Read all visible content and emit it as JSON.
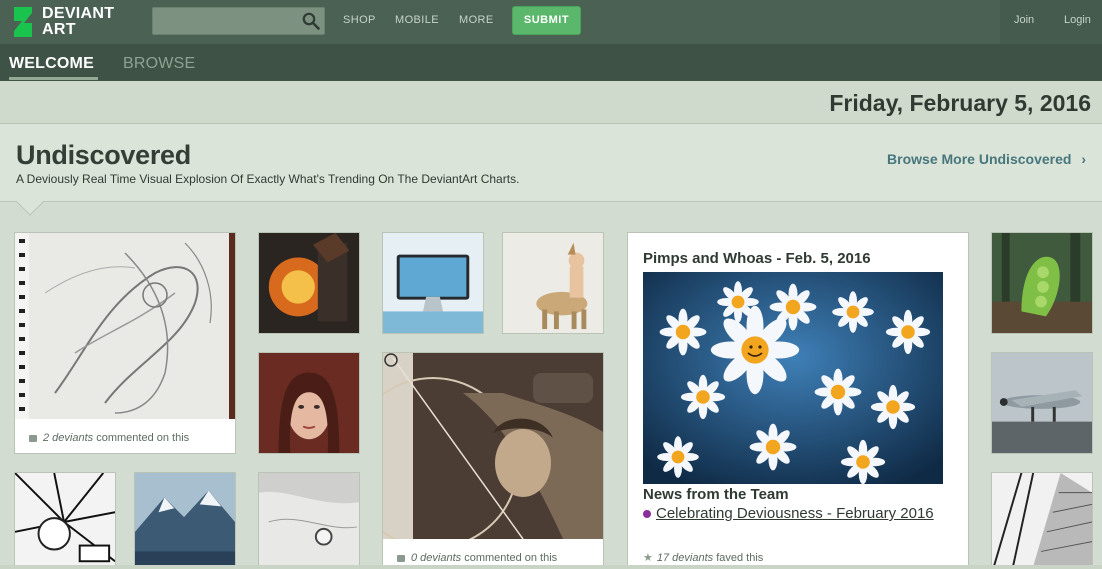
{
  "brand": {
    "line1": "DEVIANT",
    "line2": "ART"
  },
  "search": {
    "placeholder": ""
  },
  "nav": {
    "shop": "SHOP",
    "mobile": "MOBILE",
    "more": "MORE",
    "submit": "SUBMIT"
  },
  "account": {
    "join": "Join",
    "login": "Login"
  },
  "tabs": {
    "welcome": "WELCOME",
    "browse": "BROWSE"
  },
  "date": "Friday, February 5, 2016",
  "section": {
    "title": "Undiscovered",
    "subtitle": "A Deviously Real Time Visual Explosion Of Exactly What's Trending On The DeviantArt Charts.",
    "browse_more": "Browse More Undiscovered",
    "browse_more_chevron": "›"
  },
  "cards": {
    "sketch": {
      "count": "2 deviants",
      "text": "commented on this"
    },
    "archer": {
      "count": "0 deviants",
      "text": "commented on this"
    }
  },
  "feature": {
    "title": "Pimps and Whoas - Feb. 5, 2016",
    "news_title": "News from the Team",
    "news_link": "Celebrating Deviousness - February 2016",
    "faved_count": "17 deviants",
    "faved_text": "faved this"
  },
  "colors": {
    "topbar": "#4a6153",
    "subbar": "#3e5245",
    "submit": "#5bb76b",
    "link": "#47767d",
    "page": "#d2dcd0"
  }
}
